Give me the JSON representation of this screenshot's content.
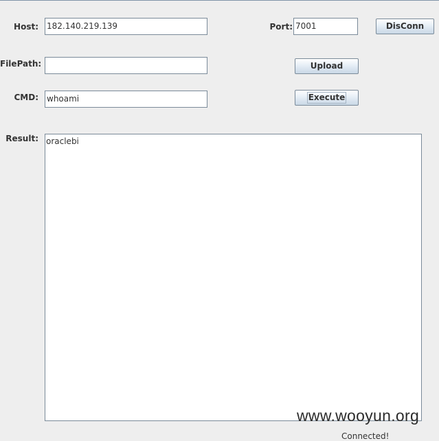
{
  "form": {
    "host": {
      "label": "Host:",
      "value": "182.140.219.139"
    },
    "port": {
      "label": "Port:",
      "value": "7001"
    },
    "filepath": {
      "label": "FilePath:",
      "value": ""
    },
    "cmd": {
      "label": "CMD:",
      "value": "whoami"
    },
    "result": {
      "label": "Result:",
      "value": "oraclebi"
    }
  },
  "buttons": {
    "disconnect": "DisConn",
    "upload": "Upload",
    "execute": "Execute"
  },
  "watermark": "www.wooyun.org",
  "status_partial": "Connected!"
}
